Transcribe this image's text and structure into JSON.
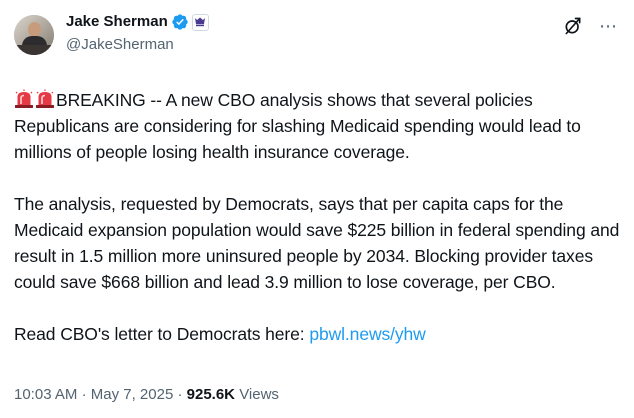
{
  "author": {
    "display_name": "Jake Sherman",
    "handle": "@JakeSherman",
    "verified": true
  },
  "tweet": {
    "paragraph1": "BREAKING -- A new CBO analysis shows that several policies Republicans are considering for slashing Medicaid spending would lead to millions of people losing health insurance coverage.",
    "paragraph2": "The analysis, requested by Democrats, says that per capita caps for the Medicaid expansion population would save $225 billion in federal spending and result in 1.5 million more uninsured people by 2034. Blocking provider taxes could save $668 billion and lead 3.9 million to lose coverage, per CBO.",
    "paragraph3_prefix": "Read CBO's letter to Democrats here: ",
    "link_text": "pbwl.news/yhw"
  },
  "meta": {
    "time": "10:03 AM",
    "separator": "·",
    "date": "May 7, 2025",
    "views_count": "925.6K",
    "views_label": "Views"
  },
  "colors": {
    "link": "#1d9bf0",
    "verified_badge": "#1d9bf0",
    "secondary_text": "#536471",
    "primary_text": "#0f1419"
  },
  "icons": [
    "siren-emoji",
    "verified-badge-icon",
    "affiliate-badge-icon",
    "grok-icon",
    "more-options-icon"
  ]
}
